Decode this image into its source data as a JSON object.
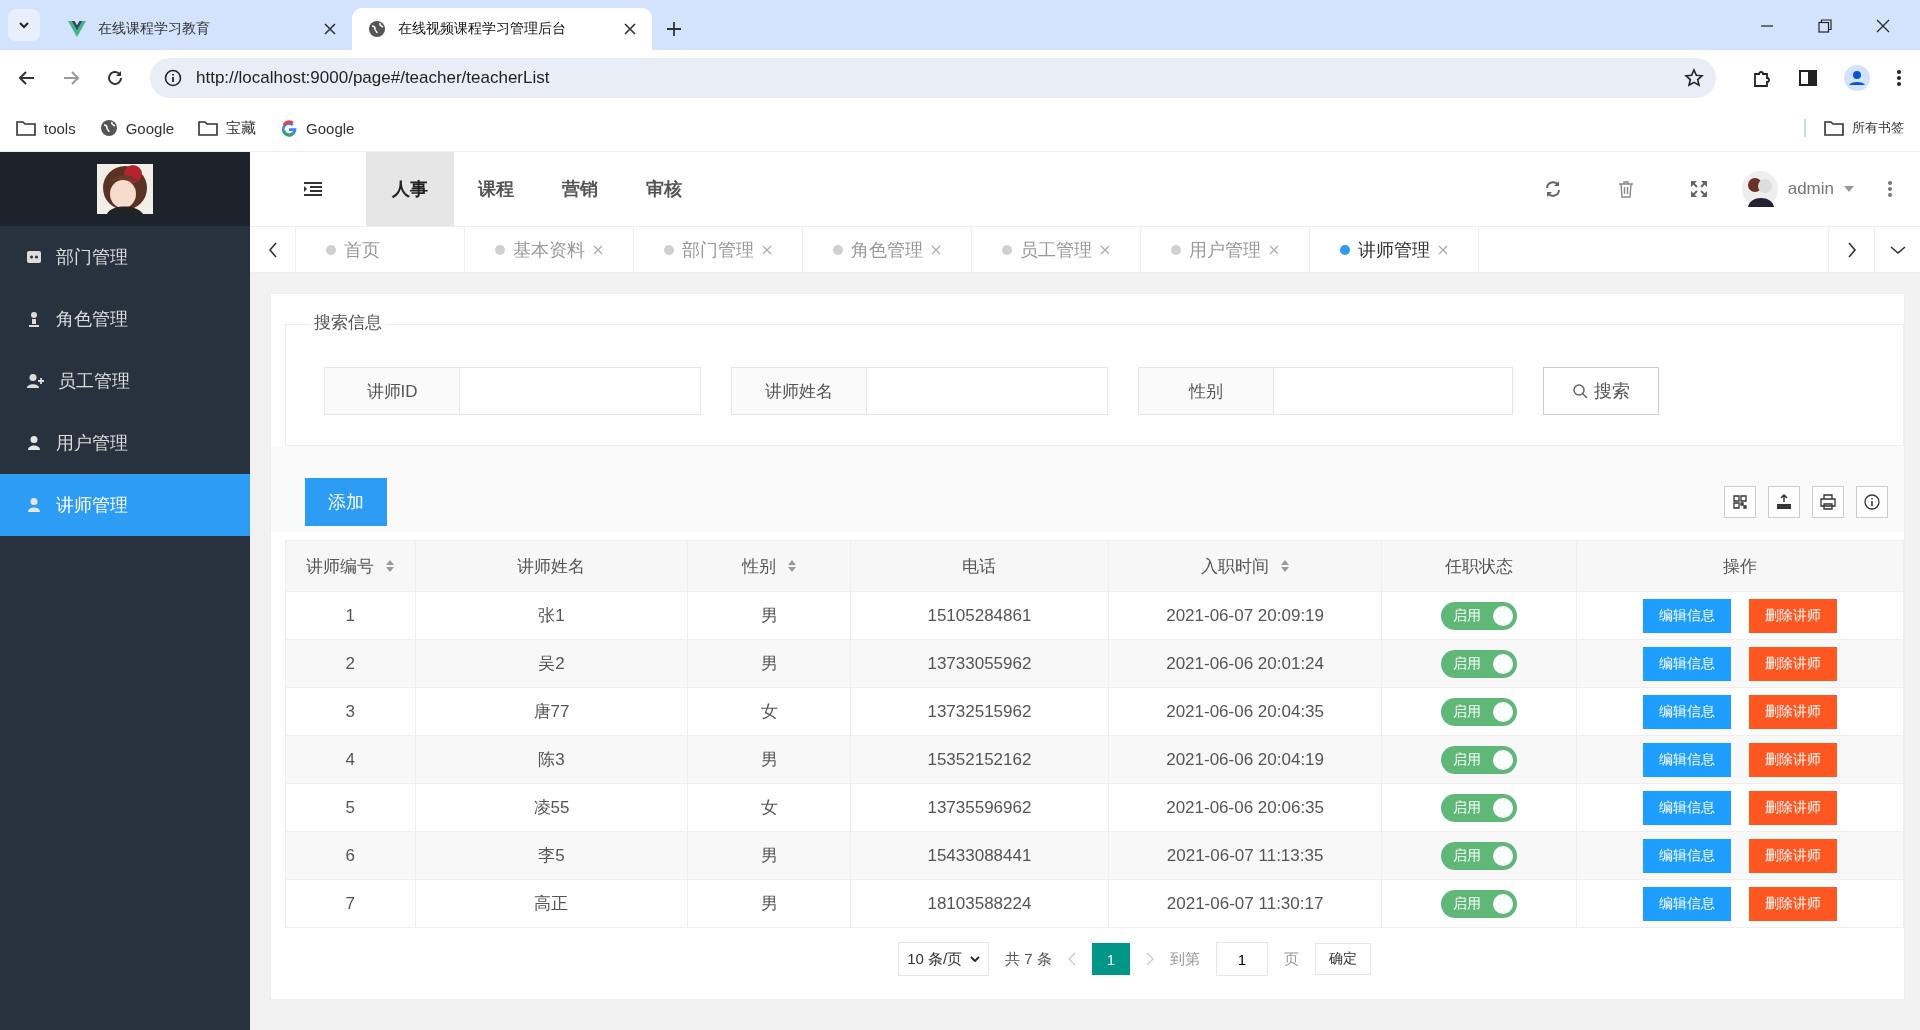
{
  "browser": {
    "tabs": [
      {
        "title": "在线课程学习教育",
        "selected": false,
        "kind": "vue"
      },
      {
        "title": "在线视频课程学习管理后台",
        "selected": true,
        "kind": "globe"
      }
    ],
    "url": "http://localhost:9000/page#/teacher/teacherList",
    "bookmarks": [
      {
        "label": "tools",
        "kind": "folder"
      },
      {
        "label": "Google",
        "kind": "globe"
      },
      {
        "label": "宝藏",
        "kind": "folder"
      },
      {
        "label": "Google",
        "kind": "g"
      }
    ],
    "all_bookmarks": "所有书签"
  },
  "sidebar": {
    "items": [
      {
        "label": "部门管理",
        "selected": false,
        "kind": "dept"
      },
      {
        "label": "角色管理",
        "selected": false,
        "kind": "role"
      },
      {
        "label": "员工管理",
        "selected": false,
        "kind": "staff"
      },
      {
        "label": "用户管理",
        "selected": false,
        "kind": "user"
      },
      {
        "label": "讲师管理",
        "selected": true,
        "kind": "user"
      }
    ]
  },
  "top_nav": [
    {
      "label": "人事",
      "selected": true
    },
    {
      "label": "课程",
      "selected": false
    },
    {
      "label": "营销",
      "selected": false
    },
    {
      "label": "审核",
      "selected": false
    }
  ],
  "user": {
    "name": "admin"
  },
  "page_tabs": [
    {
      "label": "首页",
      "selected": false,
      "closable": false
    },
    {
      "label": "基本资料",
      "selected": false,
      "closable": true
    },
    {
      "label": "部门管理",
      "selected": false,
      "closable": true
    },
    {
      "label": "角色管理",
      "selected": false,
      "closable": true
    },
    {
      "label": "员工管理",
      "selected": false,
      "closable": true
    },
    {
      "label": "用户管理",
      "selected": false,
      "closable": true
    },
    {
      "label": "讲师管理",
      "selected": true,
      "closable": true
    }
  ],
  "search": {
    "title": "搜索信息",
    "fields": [
      {
        "label": "讲师ID"
      },
      {
        "label": "讲师姓名"
      },
      {
        "label": "性别"
      }
    ],
    "button": "搜索"
  },
  "add_button": "添加",
  "table": {
    "columns": [
      {
        "label": "讲师编号",
        "sortable": true
      },
      {
        "label": "讲师姓名",
        "sortable": false
      },
      {
        "label": "性别",
        "sortable": true
      },
      {
        "label": "电话",
        "sortable": false
      },
      {
        "label": "入职时间",
        "sortable": true
      },
      {
        "label": "任职状态",
        "sortable": false
      },
      {
        "label": "操作",
        "sortable": false
      }
    ],
    "rows": [
      {
        "cells": [
          "1",
          "张1",
          "男",
          "15105284861",
          "2021-06-07 20:09:19"
        ],
        "status": {
          "label": "启用",
          "on": true
        },
        "actions": [
          {
            "label": "编辑信息",
            "kind": "edit"
          },
          {
            "label": "删除讲师",
            "kind": "delete"
          }
        ]
      },
      {
        "cells": [
          "2",
          "吴2",
          "男",
          "13733055962",
          "2021-06-06 20:01:24"
        ],
        "status": {
          "label": "启用",
          "on": true
        },
        "actions": [
          {
            "label": "编辑信息",
            "kind": "edit"
          },
          {
            "label": "删除讲师",
            "kind": "delete"
          }
        ]
      },
      {
        "cells": [
          "3",
          "唐77",
          "女",
          "13732515962",
          "2021-06-06 20:04:35"
        ],
        "status": {
          "label": "启用",
          "on": true
        },
        "actions": [
          {
            "label": "编辑信息",
            "kind": "edit"
          },
          {
            "label": "删除讲师",
            "kind": "delete"
          }
        ]
      },
      {
        "cells": [
          "4",
          "陈3",
          "男",
          "15352152162",
          "2021-06-06 20:04:19"
        ],
        "status": {
          "label": "启用",
          "on": true
        },
        "actions": [
          {
            "label": "编辑信息",
            "kind": "edit"
          },
          {
            "label": "删除讲师",
            "kind": "delete"
          }
        ]
      },
      {
        "cells": [
          "5",
          "凌55",
          "女",
          "13735596962",
          "2021-06-06 20:06:35"
        ],
        "status": {
          "label": "启用",
          "on": true
        },
        "actions": [
          {
            "label": "编辑信息",
            "kind": "edit"
          },
          {
            "label": "删除讲师",
            "kind": "delete"
          }
        ]
      },
      {
        "cells": [
          "6",
          "李5",
          "男",
          "15433088441",
          "2021-06-07 11:13:35"
        ],
        "status": {
          "label": "启用",
          "on": true
        },
        "actions": [
          {
            "label": "编辑信息",
            "kind": "edit"
          },
          {
            "label": "删除讲师",
            "kind": "delete"
          }
        ]
      },
      {
        "cells": [
          "7",
          "高正",
          "男",
          "18103588224",
          "2021-06-07 11:30:17"
        ],
        "status": {
          "label": "启用",
          "on": true
        },
        "actions": [
          {
            "label": "编辑信息",
            "kind": "edit"
          },
          {
            "label": "删除讲师",
            "kind": "delete"
          }
        ]
      }
    ]
  },
  "pagination": {
    "page_size": "10 条/页",
    "total": "共 7 条",
    "pages": [
      {
        "label": "1",
        "selected": true
      }
    ],
    "goto_label": "到第",
    "goto_value": "1",
    "page_unit": "页",
    "confirm": "确定"
  }
}
